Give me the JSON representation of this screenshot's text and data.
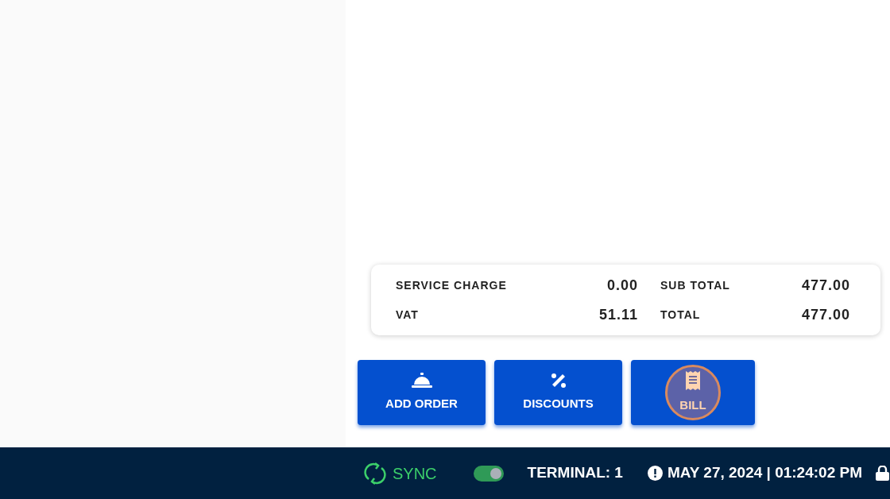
{
  "summary": {
    "rows": [
      {
        "label": "SERVICE CHARGE",
        "value": "0.00",
        "label_2": "SUB TOTAL",
        "value_2": "477.00"
      },
      {
        "label": "VAT",
        "value": "51.11",
        "label_2": "TOTAL",
        "value_2": "477.00"
      }
    ]
  },
  "actions": [
    {
      "kind": "bell",
      "label": "ADD ORDER",
      "pressed": false
    },
    {
      "kind": "percent",
      "label": "DISCOUNTS",
      "pressed": false
    },
    {
      "kind": "receipt",
      "label": "BILL",
      "pressed": true
    }
  ],
  "status_bar": {
    "sync": "SYNC",
    "online": true,
    "terminal": "TERMINAL: 1",
    "datetime": "MAY 27, 2024 | 01:24:02 PM"
  }
}
